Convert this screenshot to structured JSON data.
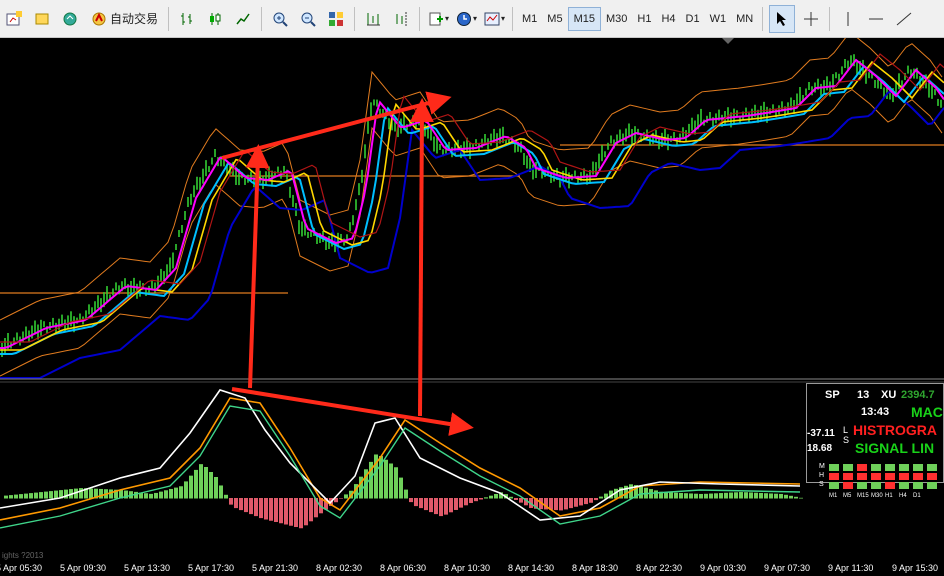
{
  "toolbar": {
    "autotrade_label": "自动交易",
    "timeframes": [
      "M1",
      "M5",
      "M15",
      "M30",
      "H1",
      "H4",
      "D1",
      "W1",
      "MN"
    ],
    "active_timeframe": "M15",
    "icons": [
      "new-chart-icon",
      "profiles-icon",
      "market-watch-icon",
      "autotrading-icon",
      "bar-chart-icon",
      "candlestick-icon",
      "line-chart-icon",
      "zoom-in-icon",
      "zoom-out-icon",
      "tile-windows-icon",
      "auto-scroll-icon",
      "chart-shift-icon",
      "indicators-icon",
      "periods-icon",
      "templates-icon",
      "cursor-icon",
      "crosshair-icon",
      "vertical-line-icon",
      "horizontal-line-icon",
      "trendline-icon"
    ]
  },
  "time_axis": [
    "5 Apr 05:30",
    "5 Apr 09:30",
    "5 Apr 13:30",
    "5 Apr 17:30",
    "5 Apr 21:30",
    "8 Apr 02:30",
    "8 Apr 06:30",
    "8 Apr 10:30",
    "8 Apr 14:30",
    "8 Apr 18:30",
    "8 Apr 22:30",
    "9 Apr 03:30",
    "9 Apr 07:30",
    "9 Apr 11:30",
    "9 Apr 15:30"
  ],
  "copyright": "ights ?2013",
  "panel": {
    "symbol": "SP",
    "num": "13",
    "instrument": "XU",
    "price": "2394.7",
    "time": "13:43",
    "title": "MAC",
    "histogram": "HISTROGRA",
    "signal": "SIGNAL LIN",
    "val1": "-37.11",
    "val2": "18.68",
    "l": "L",
    "s": "S",
    "row_labels": [
      "M",
      "H",
      "S"
    ],
    "timeframes": [
      "M1",
      "M5",
      "M15",
      "M30",
      "H1",
      "H4",
      "D1"
    ]
  },
  "colors": {
    "up_candle": "#32cd32",
    "ma_fast": "#ff00ff",
    "ma_yellow": "#ffd700",
    "ma_cyan": "#00bfff",
    "ma_blue": "#0000cd",
    "envelope": "#e07b1f",
    "arrows": "#ff2a1a",
    "hist_pos": "#6fd05a",
    "hist_neg": "#e05a6a",
    "macd_line": "#ffffff",
    "signal_line": "#ff9900"
  }
}
